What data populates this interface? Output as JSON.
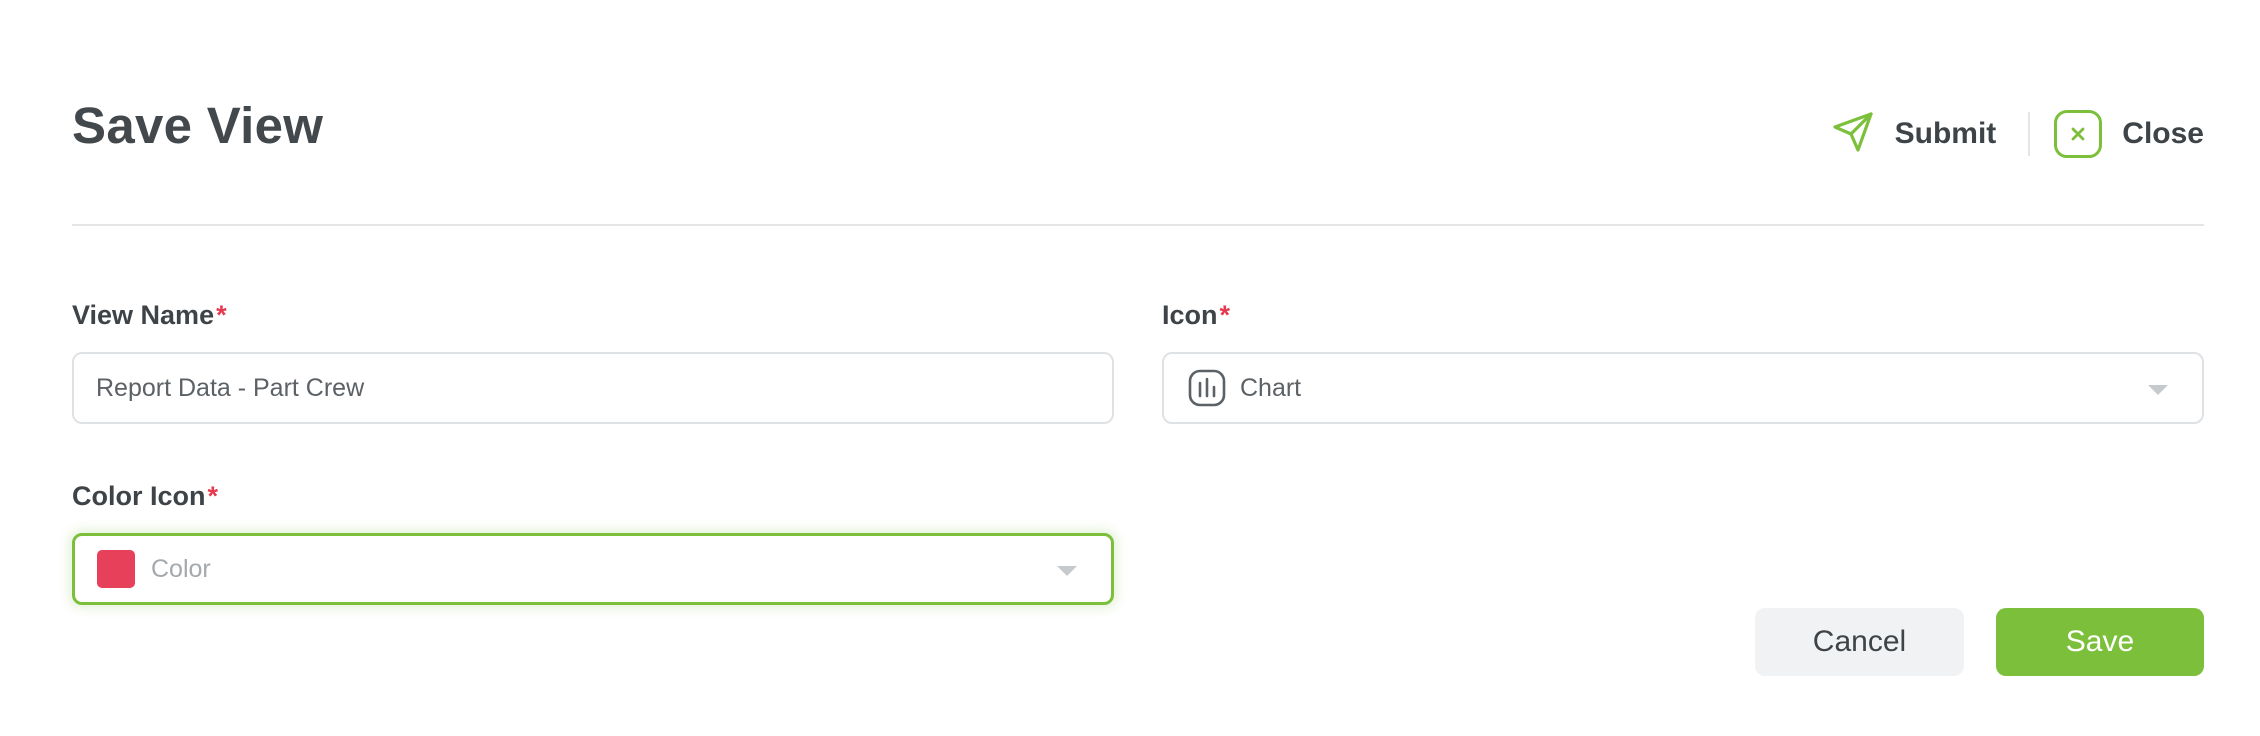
{
  "header": {
    "title": "Save View",
    "submit_label": "Submit",
    "close_label": "Close"
  },
  "form": {
    "view_name": {
      "label": "View Name",
      "required_mark": "*",
      "value": "Report Data - Part Crew"
    },
    "icon": {
      "label": "Icon",
      "required_mark": "*",
      "selected": "Chart",
      "selected_icon": "bar-chart-icon"
    },
    "color_icon": {
      "label": "Color Icon",
      "required_mark": "*",
      "placeholder": "Color",
      "swatch_color": "#e6405a"
    }
  },
  "footer": {
    "cancel_label": "Cancel",
    "save_label": "Save"
  },
  "colors": {
    "accent": "#7bbf3a",
    "required": "#e53950"
  }
}
